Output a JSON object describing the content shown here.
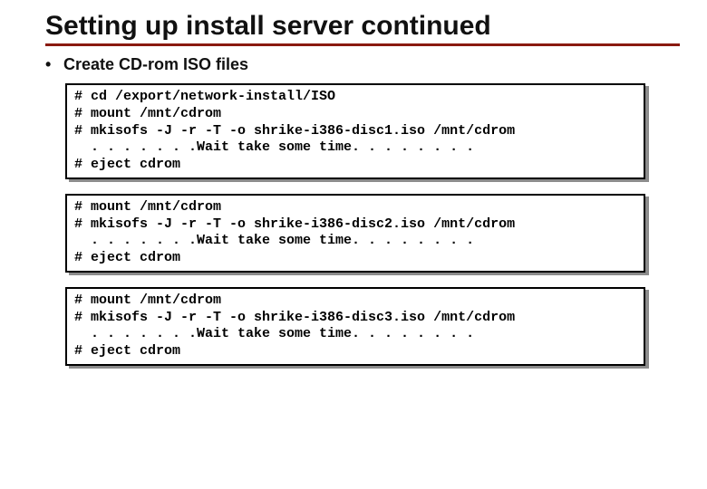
{
  "title": "Setting up install server continued",
  "bullet": "Create CD-rom ISO files",
  "codeblocks": {
    "block1": "# cd /export/network-install/ISO\n# mount /mnt/cdrom\n# mkisofs -J -r -T -o shrike-i386-disc1.iso /mnt/cdrom\n  . . . . . . .Wait take some time. . . . . . . .\n# eject cdrom",
    "block2": "# mount /mnt/cdrom\n# mkisofs -J -r -T -o shrike-i386-disc2.iso /mnt/cdrom\n  . . . . . . .Wait take some time. . . . . . . .\n# eject cdrom",
    "block3": "# mount /mnt/cdrom\n# mkisofs -J -r -T -o shrike-i386-disc3.iso /mnt/cdrom\n  . . . . . . .Wait take some time. . . . . . . .\n# eject cdrom"
  }
}
